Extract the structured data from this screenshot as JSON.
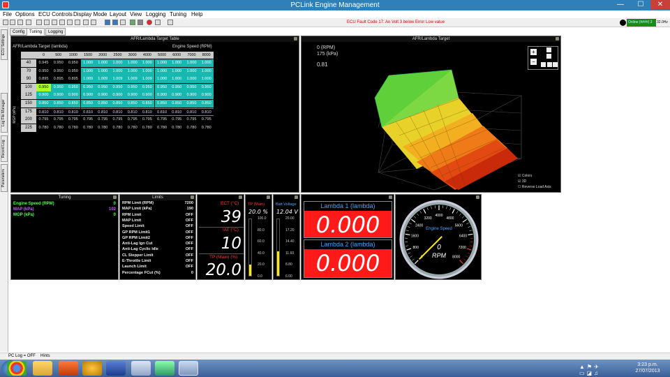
{
  "window": {
    "title": "PCLink Engine Management",
    "min": "—",
    "max": "☐",
    "close": "✕"
  },
  "menu": [
    "File",
    "Options",
    "ECU Controls",
    "Display Mode",
    "Layout",
    "View",
    "Logging",
    "Tuning",
    "Help"
  ],
  "fault_text": "ECU Fault Code 17: An Volt 3 below Error Low value",
  "online": {
    "label": "Online",
    "value": "(####) 3",
    "freq": "32.0Hz"
  },
  "top_tabs": [
    "Config",
    "Tuning",
    "Logging"
  ],
  "side_tabs": [
    "ECU Settings",
    "Log File Manager",
    "Recent Log",
    "Parameters"
  ],
  "table": {
    "title": "AFR/Lambda Target Table",
    "subtitle": "AFR/Lambda Target (lambda)",
    "x_axis": "Engine Speed (RPM)",
    "y_axis": "MGP (kPa)",
    "cols": [
      "0",
      "500",
      "1000",
      "1500",
      "2000",
      "2500",
      "3000",
      "4000",
      "5000",
      "6000",
      "7000",
      "8000"
    ],
    "rows": [
      {
        "label": "40",
        "vals": [
          "0.945",
          "0.950",
          "0.950",
          "1.000",
          "1.000",
          "1.000",
          "1.000",
          "1.000",
          "1.000",
          "1.000",
          "1.000",
          "1.000"
        ]
      },
      {
        "label": "70",
        "vals": [
          "0.950",
          "0.950",
          "0.950",
          "1.000",
          "1.000",
          "1.000",
          "1.000",
          "1.000",
          "1.000",
          "1.000",
          "1.000",
          "1.000"
        ]
      },
      {
        "label": "90",
        "vals": [
          "0.895",
          "0.895",
          "0.895",
          "1.009",
          "1.009",
          "1.009",
          "1.009",
          "1.009",
          "1.000",
          "1.000",
          "1.000",
          "1.000"
        ]
      },
      {
        "label": "100",
        "vals": [
          "0.950",
          "0.950",
          "0.950",
          "0.950",
          "0.950",
          "0.950",
          "0.950",
          "0.950",
          "0.950",
          "0.950",
          "0.950",
          "0.950"
        ]
      },
      {
        "label": "125",
        "vals": [
          "0.900",
          "0.900",
          "0.900",
          "0.900",
          "0.900",
          "0.900",
          "0.900",
          "0.900",
          "0.900",
          "0.900",
          "0.900",
          "0.900"
        ]
      },
      {
        "label": "150",
        "vals": [
          "0.850",
          "0.850",
          "0.850",
          "0.850",
          "0.850",
          "0.850",
          "0.850",
          "0.850",
          "0.850",
          "0.850",
          "0.850",
          "0.850"
        ]
      },
      {
        "label": "175",
        "vals": [
          "0.810",
          "0.810",
          "0.810",
          "0.810",
          "0.810",
          "0.810",
          "0.810",
          "0.810",
          "0.810",
          "0.810",
          "0.810",
          "0.810"
        ]
      },
      {
        "label": "200",
        "vals": [
          "0.795",
          "0.795",
          "0.795",
          "0.795",
          "0.795",
          "0.795",
          "0.795",
          "0.795",
          "0.795",
          "0.795",
          "0.795",
          "0.795"
        ]
      },
      {
        "label": "225",
        "vals": [
          "0.780",
          "0.780",
          "0.780",
          "0.780",
          "0.780",
          "0.780",
          "0.780",
          "0.780",
          "0.780",
          "0.780",
          "0.780",
          "0.780"
        ]
      }
    ]
  },
  "graph3d": {
    "title": "AFR/Lambda Target",
    "rpm": "0 (RPM)",
    "kpa": "175 (kPa)",
    "value": "0.81",
    "checks": [
      "Colors",
      "3D",
      "Reverse Load Axis"
    ],
    "zoom_in": "+",
    "zoom_out": "−"
  },
  "tuning_panel": {
    "title": "Tuning",
    "rows": [
      {
        "label": "Engine Speed (RPM)",
        "value": "0",
        "color": "#4cff4c"
      },
      {
        "label": "MAP (kPa)",
        "value": "102",
        "color": "#c65cff"
      },
      {
        "label": "MGP (kPa)",
        "value": "0",
        "color": "#4cff4c"
      }
    ]
  },
  "limits_panel": {
    "title": "Limits",
    "rows": [
      {
        "label": "RPM Limit (RPM)",
        "value": "7200"
      },
      {
        "label": "MAP Limit (kPa)",
        "value": "190"
      },
      {
        "label": "RPM Limit",
        "value": "OFF"
      },
      {
        "label": "MAP Limit",
        "value": "OFF"
      },
      {
        "label": "Speed Limit",
        "value": "OFF"
      },
      {
        "label": "GP RPM Limit1",
        "value": "OFF"
      },
      {
        "label": "GP RPM Limit2",
        "value": "OFF"
      },
      {
        "label": "Anti-Lag Ign Cut",
        "value": "OFF"
      },
      {
        "label": "Anti-Lag Cyclic Idle",
        "value": "OFF"
      },
      {
        "label": "CL Stepper Limit",
        "value": "OFF"
      },
      {
        "label": "E-Throttle Limit",
        "value": "OFF"
      },
      {
        "label": "Launch Limit",
        "value": "OFF"
      },
      {
        "label": "Percentage FCut (%)",
        "value": "0"
      }
    ]
  },
  "digital": [
    {
      "title": "ECT (°C)",
      "value": "39"
    },
    {
      "title": "IAT (°C)",
      "value": "10"
    },
    {
      "title": "TP (Main) (%)",
      "value": "20.0"
    }
  ],
  "bar1": {
    "title": "TP (Main)",
    "value": "20.0 %",
    "ticks": [
      "100.0",
      "80.0",
      "60.0",
      "40.0",
      "20.0",
      "0.0"
    ],
    "fill": 0.2
  },
  "bar2": {
    "title": "Batt Voltage",
    "value": "12.04 V",
    "ticks": [
      "20.00",
      "17.20",
      "14.40",
      "11.60",
      "8.80",
      "6.00"
    ],
    "fill": 0.43
  },
  "lambda": [
    {
      "title": "Lambda 1 (lambda)",
      "value": "0.000"
    },
    {
      "title": "Lambda 2 (lambda)",
      "value": "0.000"
    }
  ],
  "tacho": {
    "label": "Engine Speed",
    "value": "0",
    "unit": "RPM",
    "ticks": [
      "0",
      "800",
      "1600",
      "2400",
      "3200",
      "4000",
      "4800",
      "5600",
      "6400",
      "7200",
      "8000"
    ],
    "rpm": 0
  },
  "statusbar": {
    "log": "PC Log = OFF",
    "hints": "Hints"
  },
  "clock": {
    "time": "3:23 p.m.",
    "date": "27/07/2013"
  },
  "taskbar_apps": [
    "chrome-icon",
    "explorer-icon",
    "office-icon",
    "network-icon",
    "help-icon",
    "window-icon",
    "app-icon",
    "link-icon"
  ]
}
